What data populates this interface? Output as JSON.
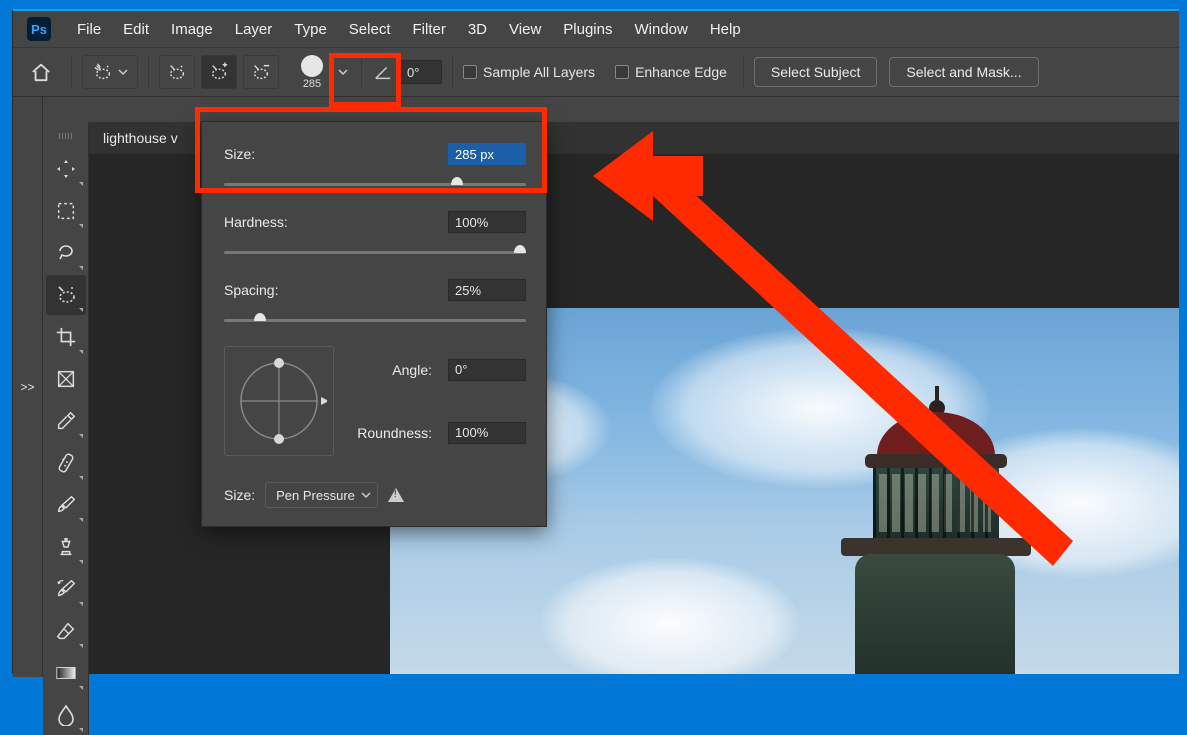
{
  "app": {
    "logo_text": "Ps"
  },
  "menu": [
    "File",
    "Edit",
    "Image",
    "Layer",
    "Type",
    "Select",
    "Filter",
    "3D",
    "View",
    "Plugins",
    "Window",
    "Help"
  ],
  "options": {
    "brush_size_preview": "285",
    "angle_field": "0°",
    "sample_all_layers": "Sample All Layers",
    "enhance_edge": "Enhance Edge",
    "select_subject": "Select Subject",
    "select_and_mask": "Select and Mask..."
  },
  "tab": {
    "title": "lighthouse v"
  },
  "tools": [
    {
      "name": "move-tool"
    },
    {
      "name": "marquee-tool"
    },
    {
      "name": "lasso-tool"
    },
    {
      "name": "quick-selection-tool",
      "selected": true
    },
    {
      "name": "crop-tool"
    },
    {
      "name": "frame-tool"
    },
    {
      "name": "eyedropper-tool"
    },
    {
      "name": "healing-brush-tool"
    },
    {
      "name": "brush-tool"
    },
    {
      "name": "clone-stamp-tool"
    },
    {
      "name": "history-brush-tool"
    },
    {
      "name": "eraser-tool"
    },
    {
      "name": "gradient-tool"
    },
    {
      "name": "blur-tool"
    }
  ],
  "brush_panel": {
    "size_label": "Size:",
    "size_value": "285 px",
    "size_pct": 77,
    "hardness_label": "Hardness:",
    "hardness_value": "100%",
    "hardness_pct": 100,
    "spacing_label": "Spacing:",
    "spacing_value": "25%",
    "spacing_pct": 12,
    "angle_label": "Angle:",
    "angle_value": "0°",
    "roundness_label": "Roundness:",
    "roundness_value": "100%",
    "size_dyn_label": "Size:",
    "size_dyn_value": "Pen Pressure"
  },
  "toolstrip_expand": ">>"
}
